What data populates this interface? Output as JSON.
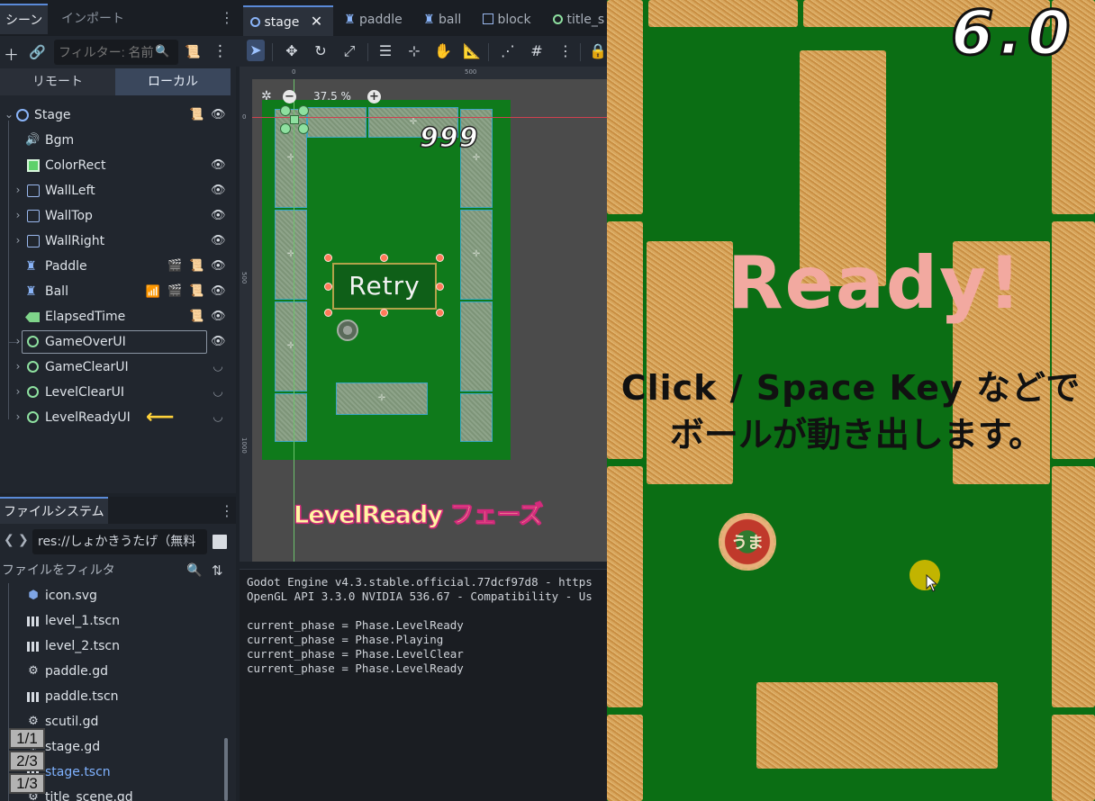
{
  "scene_dock": {
    "tabs": [
      {
        "label": "シーン"
      },
      {
        "label": "インポート"
      }
    ],
    "filter_placeholder": "フィルター: 名前",
    "segments": [
      {
        "label": "リモート"
      },
      {
        "label": "ローカル"
      }
    ],
    "nodes": [
      {
        "label": "Stage"
      },
      {
        "label": "Bgm"
      },
      {
        "label": "ColorRect"
      },
      {
        "label": "WallLeft"
      },
      {
        "label": "WallTop"
      },
      {
        "label": "WallRight"
      },
      {
        "label": "Paddle"
      },
      {
        "label": "Ball"
      },
      {
        "label": "ElapsedTime"
      },
      {
        "label": "GameOverUI"
      },
      {
        "label": "GameClearUI"
      },
      {
        "label": "LevelClearUI"
      },
      {
        "label": "LevelReadyUI"
      }
    ]
  },
  "filesystem": {
    "tab": "ファイルシステム",
    "path": "res://しょかきうたげ（無料",
    "filter_placeholder": "ファイルをフィルタ",
    "files": [
      {
        "name": "icon.svg"
      },
      {
        "name": "level_1.tscn"
      },
      {
        "name": "level_2.tscn"
      },
      {
        "name": "paddle.gd"
      },
      {
        "name": "paddle.tscn"
      },
      {
        "name": "scutil.gd"
      },
      {
        "name": "stage.gd"
      },
      {
        "name": "stage.tscn"
      },
      {
        "name": "title_scene.gd"
      }
    ],
    "badges": [
      "1/1",
      "2/3",
      "1/3"
    ]
  },
  "editor": {
    "tabs": [
      {
        "label": "stage"
      },
      {
        "label": "paddle"
      },
      {
        "label": "ball"
      },
      {
        "label": "block"
      },
      {
        "label": "title_s"
      }
    ],
    "zoom": "37.5 %",
    "ruler_top": [
      "0",
      "500"
    ],
    "ruler_left": [
      "0",
      "500",
      "1000"
    ],
    "preview_score": "999",
    "preview_button": "Retry",
    "phase_label": "LevelReady フェーズ"
  },
  "output": {
    "lines": [
      "Godot Engine v4.3.stable.official.77dcf97d8 - https",
      "OpenGL API 3.3.0 NVIDIA 536.67 - Compatibility - Us",
      "",
      "current_phase = Phase.LevelReady",
      "current_phase = Phase.Playing",
      "current_phase = Phase.LevelClear",
      "current_phase = Phase.LevelReady"
    ]
  },
  "game": {
    "timer": "6.0",
    "ready": "Ready!",
    "instruction_line1": "Click / Space Key などで",
    "instruction_line2": "ボールが動き出します。",
    "paddle_text": "うま"
  },
  "colors": {
    "accent": "#5a8ad8",
    "game_bg": "#0b6e14",
    "ready_text": "#f2a9a0",
    "phase_label": "#fff6a3"
  }
}
